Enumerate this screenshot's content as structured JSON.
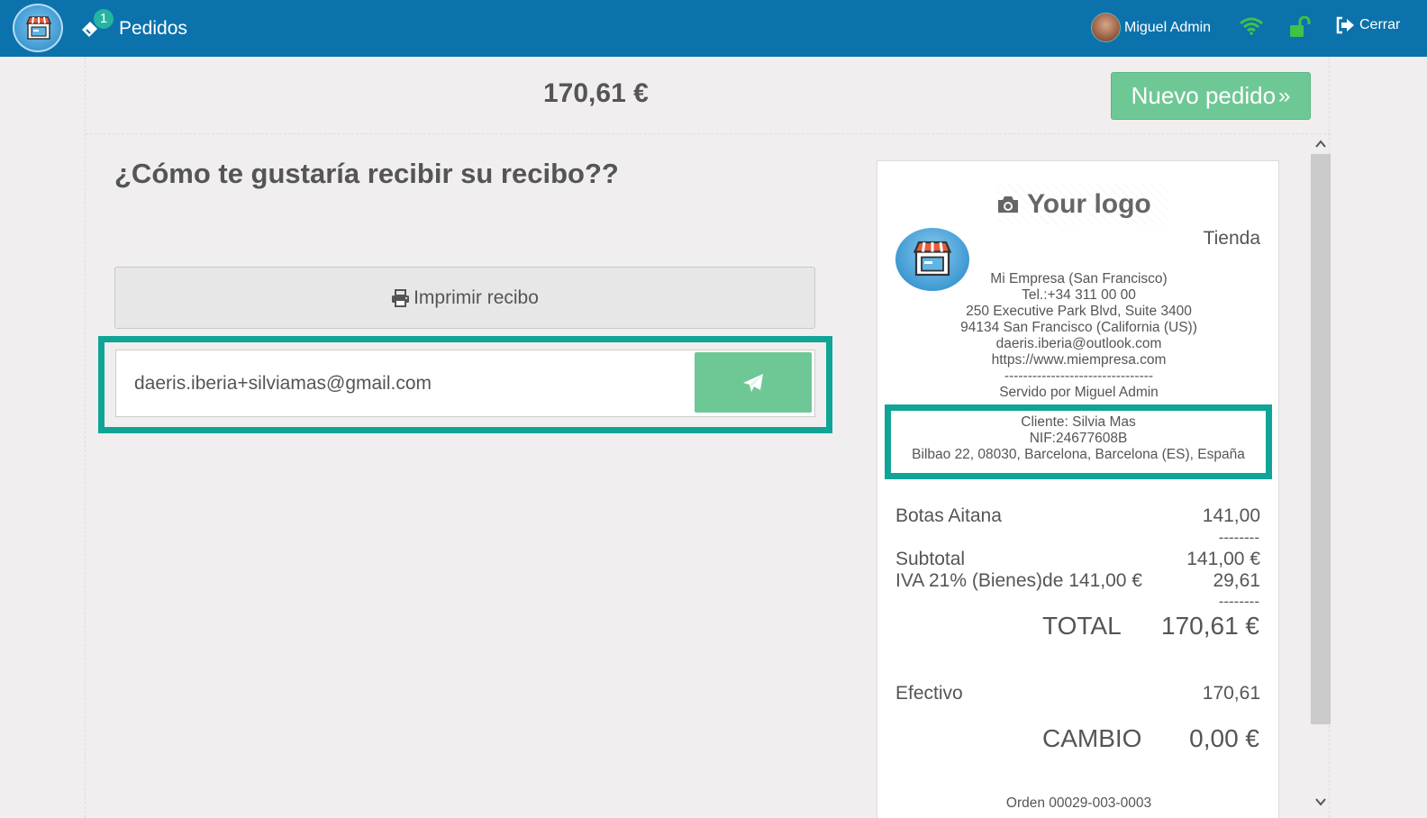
{
  "topbar": {
    "orders_label": "Pedidos",
    "orders_badge": "1",
    "user_name": "Miguel Admin",
    "logout_label": "Cerrar"
  },
  "header": {
    "total": "170,61 €",
    "new_order_label": "Nuevo pedido"
  },
  "receipt_options": {
    "question": "¿Cómo te gustaría recibir su recibo??",
    "print_label": "Imprimir recibo",
    "email_value": "daeris.iberia+silviamas@gmail.com"
  },
  "receipt": {
    "logo_placeholder": "Your logo",
    "shop_name": "Tienda",
    "company": [
      "Mi Empresa (San Francisco)",
      "Tel.:+34 311 00 00",
      "250 Executive Park Blvd, Suite 3400",
      "94134 San Francisco (California (US))",
      "daeris.iberia@outlook.com",
      "https://www.miempresa.com",
      "--------------------------------",
      "Servido por Miguel Admin"
    ],
    "client": [
      "Cliente: Silvia Mas",
      "NIF:24677608B",
      "Bilbao 22, 08030, Barcelona, Barcelona (ES), España"
    ],
    "product_name": "Botas Aitana",
    "product_price": "141,00",
    "dashes": "--------",
    "subtotal_label": "Subtotal",
    "subtotal_value": "141,00 €",
    "tax_label": "IVA 21% (Bienes)de 141,00 €",
    "tax_value": "29,61",
    "total_label": "TOTAL",
    "total_value": "170,61 €",
    "payment_label": "Efectivo",
    "payment_value": "170,61",
    "change_label": "CAMBIO",
    "change_value": "0,00 €",
    "order_number": "Orden 00029-003-0003"
  },
  "colors": {
    "topbar": "#0c72ab",
    "accent_green": "#6ec896",
    "highlight_teal": "#10a497",
    "badge": "#24b4a0"
  },
  "icons": [
    "store-logo-icon",
    "ticket-icon",
    "wifi-icon",
    "unlock-icon",
    "logout-icon",
    "camera-icon",
    "printer-icon",
    "paper-plane-icon",
    "double-chevron-right-icon",
    "chevron-up-icon",
    "chevron-down-icon"
  ]
}
